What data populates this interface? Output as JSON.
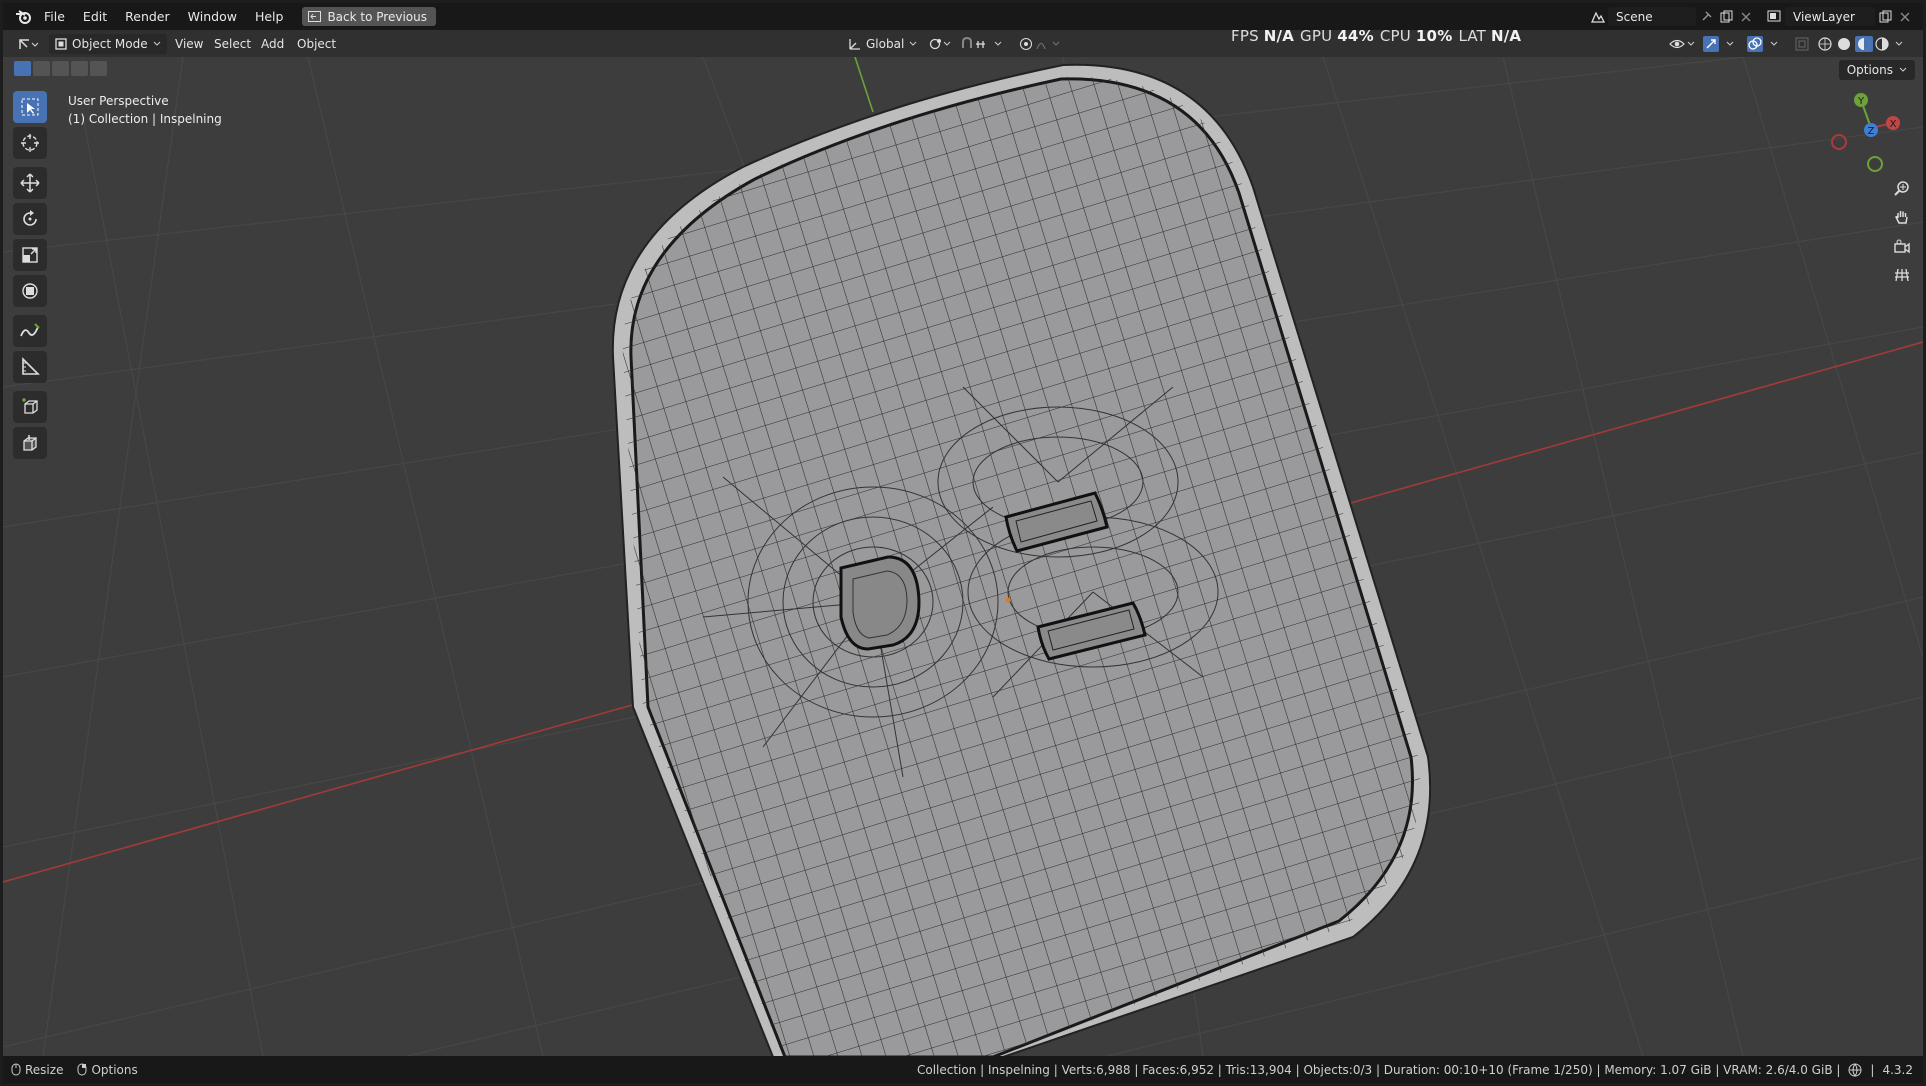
{
  "menu": {
    "items": [
      "File",
      "Edit",
      "Render",
      "Window",
      "Help"
    ],
    "back_button": "Back to Previous"
  },
  "scene": {
    "name": "Scene",
    "view_layer": "ViewLayer"
  },
  "header": {
    "mode": "Object Mode",
    "menus": [
      "View",
      "Select",
      "Add",
      "Object"
    ],
    "orientation": "Global",
    "options": "Options"
  },
  "stats": {
    "fps_label": "FPS",
    "fps_value": "N/A",
    "gpu_label": "GPU",
    "gpu_value": "44%",
    "cpu_label": "CPU",
    "cpu_value": "10%",
    "lat_label": "LAT",
    "lat_value": "N/A"
  },
  "viewport": {
    "view_name": "User Perspective",
    "collection_line": "(1) Collection | Inspelning"
  },
  "gizmo": {
    "x": "X",
    "y": "Y",
    "z": "Z"
  },
  "tools": [
    "select-box",
    "cursor",
    "move",
    "rotate",
    "scale",
    "transform",
    "annotate",
    "measure",
    "add-cube",
    "extrude"
  ],
  "status": {
    "left_resize": "Resize",
    "left_options": "Options",
    "info": "Collection | Inspelning | Verts:6,988 | Faces:6,952 | Tris:13,904 | Objects:0/3 | Duration: 00:10+10 (Frame 1/250) | Memory: 1.07 GiB | VRAM: 2.6/4.0 GiB |",
    "version": "4.3.2"
  },
  "colors": {
    "accent": "#4772b3",
    "x_axis": "#b03a3a",
    "y_axis": "#6da23a",
    "mesh_fill": "#9a9a9c"
  }
}
